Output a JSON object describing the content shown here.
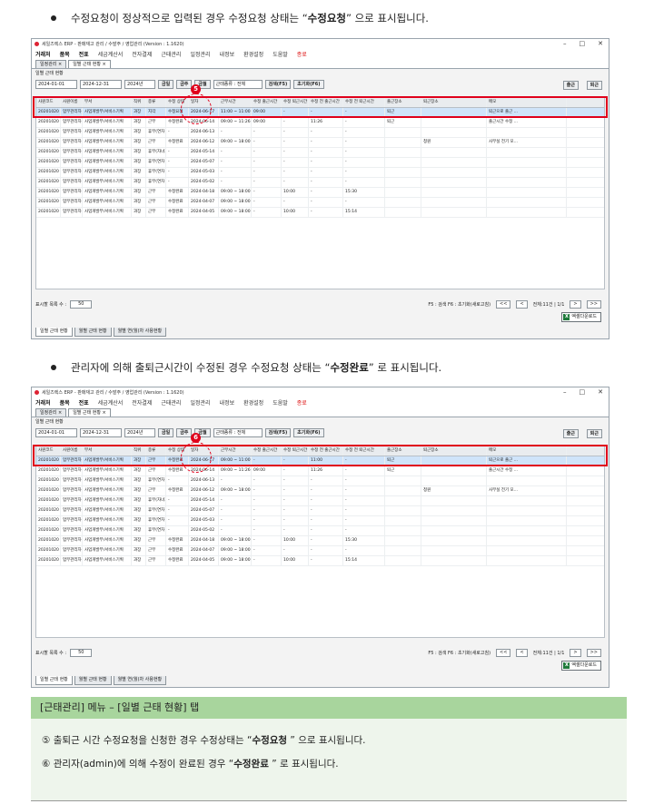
{
  "bullet1": {
    "pre": "수정요청이 정상적으로 입력된 경우 수정요청 상태는 “",
    "bold": "수정요청",
    "post": " ” 으로 표시됩니다."
  },
  "bullet2": {
    "pre": "관리자에 의해 출퇴근시간이 수정된 경우 수정요청 상태는 “",
    "bold": "수정완료",
    "post": " ” 로 표시됩니다."
  },
  "app": {
    "title": "세일즈렉스 ERP - 판매재고 관리 / 수발주 / 영업관리 (Version : 1.1620)",
    "window_controls": [
      "–",
      "□",
      "✕"
    ],
    "menu": [
      {
        "label": "거래처",
        "bold": true
      },
      {
        "label": "품목",
        "bold": true
      },
      {
        "label": "전표",
        "bold": true
      },
      {
        "label": "세금계산서",
        "bold": false
      },
      {
        "label": "전자결제",
        "bold": false
      },
      {
        "label": "근태관리",
        "bold": false
      },
      {
        "label": "일정관리",
        "bold": false
      },
      {
        "label": "내정보",
        "bold": false
      },
      {
        "label": "환경설정",
        "bold": false
      },
      {
        "label": "도움말",
        "bold": false
      },
      {
        "label": "종료",
        "bold": false,
        "red": true
      }
    ],
    "top_tabs": [
      "일정관리 ×",
      "일별 근태 현황 ×"
    ],
    "section_title": "일별 근태 현황",
    "toolbar": {
      "date_from": "2024-01-01",
      "date_to": "2024-12-31",
      "year": "2024년",
      "btn_year": "금일",
      "btn_week": "금주",
      "btn_month": "금월",
      "type_label": "근태종류 : 전체",
      "search": "검색(F5)",
      "reset": "초기화(F6)",
      "checkin": "출근",
      "checkout": "퇴근"
    },
    "columns": [
      "사원코드",
      "사원이름",
      "부서",
      "직위",
      "종류",
      "수정 상태",
      "일자",
      "근무시간",
      "수정 출근시간",
      "수정 퇴근시간",
      "수정 전 출근시간",
      "수정 전 퇴근시간",
      "출근장소",
      "퇴근장소",
      "메모"
    ],
    "rows1": [
      [
        "20201020",
        "업무관리자",
        "사업개발부/서비스기획",
        "과장",
        "지각",
        "수정요청",
        "2024-06-17",
        "11:00 ~ 11:00",
        "09:00",
        "-",
        "-",
        "-",
        "퇴근",
        "",
        "퇴근으로 출근 ..."
      ],
      [
        "20201020",
        "업무관리자",
        "사업개발부/서비스기획",
        "과장",
        "근무",
        "수정완료",
        "2024-06-14",
        "09:00 ~ 11:26",
        "09:00",
        "-",
        "11:26",
        "-",
        "퇴근",
        "",
        "출근시간 수정 ..."
      ],
      [
        "20201020",
        "업무관리자",
        "사업개발부/서비스기획",
        "과장",
        "휴무(연차 1일)",
        "-",
        "2024-06-13",
        "-",
        "-",
        "-",
        "-",
        "-",
        "",
        "",
        ""
      ],
      [
        "20201020",
        "업무관리자",
        "사업개발부/서비스기획",
        "과장",
        "근무",
        "수정완료",
        "2024-06-12",
        "09:00 ~ 18:00",
        "-",
        "-",
        "-",
        "-",
        "",
        "청원",
        "사무실 전기 모..."
      ],
      [
        "20201020",
        "업무관리자",
        "사업개발부/서비스기획",
        "과장",
        "휴무(자녀휴원)",
        "-",
        "2024-05-14",
        "-",
        "-",
        "-",
        "-",
        "-",
        "",
        "",
        ""
      ],
      [
        "20201020",
        "업무관리자",
        "사업개발부/서비스기획",
        "과장",
        "휴무(연차 1일)",
        "-",
        "2024-05-07",
        "-",
        "-",
        "-",
        "-",
        "-",
        "",
        "",
        ""
      ],
      [
        "20201020",
        "업무관리자",
        "사업개발부/서비스기획",
        "과장",
        "휴무(연차 1일)",
        "-",
        "2024-05-03",
        "-",
        "-",
        "-",
        "-",
        "-",
        "",
        "",
        ""
      ],
      [
        "20201020",
        "업무관리자",
        "사업개발부/서비스기획",
        "과장",
        "휴무(연차 1일)",
        "-",
        "2024-05-02",
        "-",
        "-",
        "-",
        "-",
        "-",
        "",
        "",
        ""
      ],
      [
        "20201020",
        "업무관리자",
        "사업개발부/서비스기획",
        "과장",
        "근무",
        "수정완료",
        "2024-04-18",
        "09:00 ~ 18:00",
        "-",
        "10:00",
        "-",
        "15:30",
        "",
        "",
        ""
      ],
      [
        "20201020",
        "업무관리자",
        "사업개발부/서비스기획",
        "과장",
        "근무",
        "수정완료",
        "2024-04-07",
        "09:00 ~ 18:00",
        "-",
        "-",
        "-",
        "-",
        "",
        "",
        ""
      ],
      [
        "20201020",
        "업무관리자",
        "사업개발부/서비스기획",
        "과장",
        "근무",
        "수정완료",
        "2024-04-05",
        "09:00 ~ 18:00",
        "-",
        "10:00",
        "-",
        "15:14",
        "",
        "",
        ""
      ]
    ],
    "rows2": [
      [
        "20201020",
        "업무관리자",
        "사업개발부/서비스기획",
        "과장",
        "근무",
        "수정완료",
        "2024-06-17",
        "09:00 ~ 11:00",
        "-",
        "-",
        "11:00",
        "-",
        "퇴근",
        "",
        "퇴근으로 출근 ..."
      ],
      [
        "20201020",
        "업무관리자",
        "사업개발부/서비스기획",
        "과장",
        "근무",
        "수정완료",
        "2024-06-14",
        "09:00 ~ 11:26",
        "09:00",
        "-",
        "11:26",
        "-",
        "퇴근",
        "",
        "출근시간 수정 ..."
      ],
      [
        "20201020",
        "업무관리자",
        "사업개발부/서비스기획",
        "과장",
        "휴무(연차 1일)",
        "-",
        "2024-06-13",
        "-",
        "-",
        "-",
        "-",
        "-",
        "",
        "",
        ""
      ],
      [
        "20201020",
        "업무관리자",
        "사업개발부/서비스기획",
        "과장",
        "근무",
        "수정완료",
        "2024-06-12",
        "09:00 ~ 18:00",
        "-",
        "-",
        "-",
        "-",
        "",
        "청원",
        "사무실 전기 모..."
      ],
      [
        "20201020",
        "업무관리자",
        "사업개발부/서비스기획",
        "과장",
        "휴무(자녀휴원)",
        "-",
        "2024-05-14",
        "-",
        "-",
        "-",
        "-",
        "-",
        "",
        "",
        ""
      ],
      [
        "20201020",
        "업무관리자",
        "사업개발부/서비스기획",
        "과장",
        "휴무(연차 1일)",
        "-",
        "2024-05-07",
        "-",
        "-",
        "-",
        "-",
        "-",
        "",
        "",
        ""
      ],
      [
        "20201020",
        "업무관리자",
        "사업개발부/서비스기획",
        "과장",
        "휴무(연차 1일)",
        "-",
        "2024-05-03",
        "-",
        "-",
        "-",
        "-",
        "-",
        "",
        "",
        ""
      ],
      [
        "20201020",
        "업무관리자",
        "사업개발부/서비스기획",
        "과장",
        "휴무(연차 1일)",
        "-",
        "2024-05-02",
        "-",
        "-",
        "-",
        "-",
        "-",
        "",
        "",
        ""
      ],
      [
        "20201020",
        "업무관리자",
        "사업개발부/서비스기획",
        "과장",
        "근무",
        "수정완료",
        "2024-04-18",
        "09:00 ~ 18:00",
        "-",
        "10:00",
        "-",
        "15:30",
        "",
        "",
        ""
      ],
      [
        "20201020",
        "업무관리자",
        "사업개발부/서비스기획",
        "과장",
        "근무",
        "수정완료",
        "2024-04-07",
        "09:00 ~ 18:00",
        "-",
        "-",
        "-",
        "-",
        "",
        "",
        ""
      ],
      [
        "20201020",
        "업무관리자",
        "사업개발부/서비스기획",
        "과장",
        "근무",
        "수정완료",
        "2024-04-05",
        "09:00 ~ 18:00",
        "-",
        "10:00",
        "-",
        "15:14",
        "",
        "",
        ""
      ]
    ],
    "pager": {
      "rows_label": "표시할 목록 수 :",
      "rows_value": "50",
      "hint": "F5 : 검색  F6 : 초기화(새로고침)",
      "first": "<<",
      "prev": "<",
      "total": "전체:11건 | 1/1",
      "next": ">",
      "last": ">>"
    },
    "excel": "엑셀다운로드",
    "bottom_tabs": [
      "일별 근태 현황",
      "월별 근태 현황",
      "월별 연(월)차 사용현황"
    ]
  },
  "markers": {
    "m1": "5",
    "m2": "6"
  },
  "highlight_color": "#e0001b",
  "panel": {
    "header": "[근태관리] 메뉴 – [일별 근태 현황] 탭",
    "line1": {
      "num": "⑤",
      "pre": " 출퇴근 시간 수정요청을 신청한 경우 수정상태는 “",
      "bold": "수정요청",
      "post": " ” 으로 표시됩니다."
    },
    "line2": {
      "num": "⑥",
      "pre": " 관리자(admin)에 의해 수정이 완료된 경우 “",
      "bold": "수정완료",
      "post": " ” 로 표시됩니다."
    },
    "header_color": "#a8d59d"
  }
}
